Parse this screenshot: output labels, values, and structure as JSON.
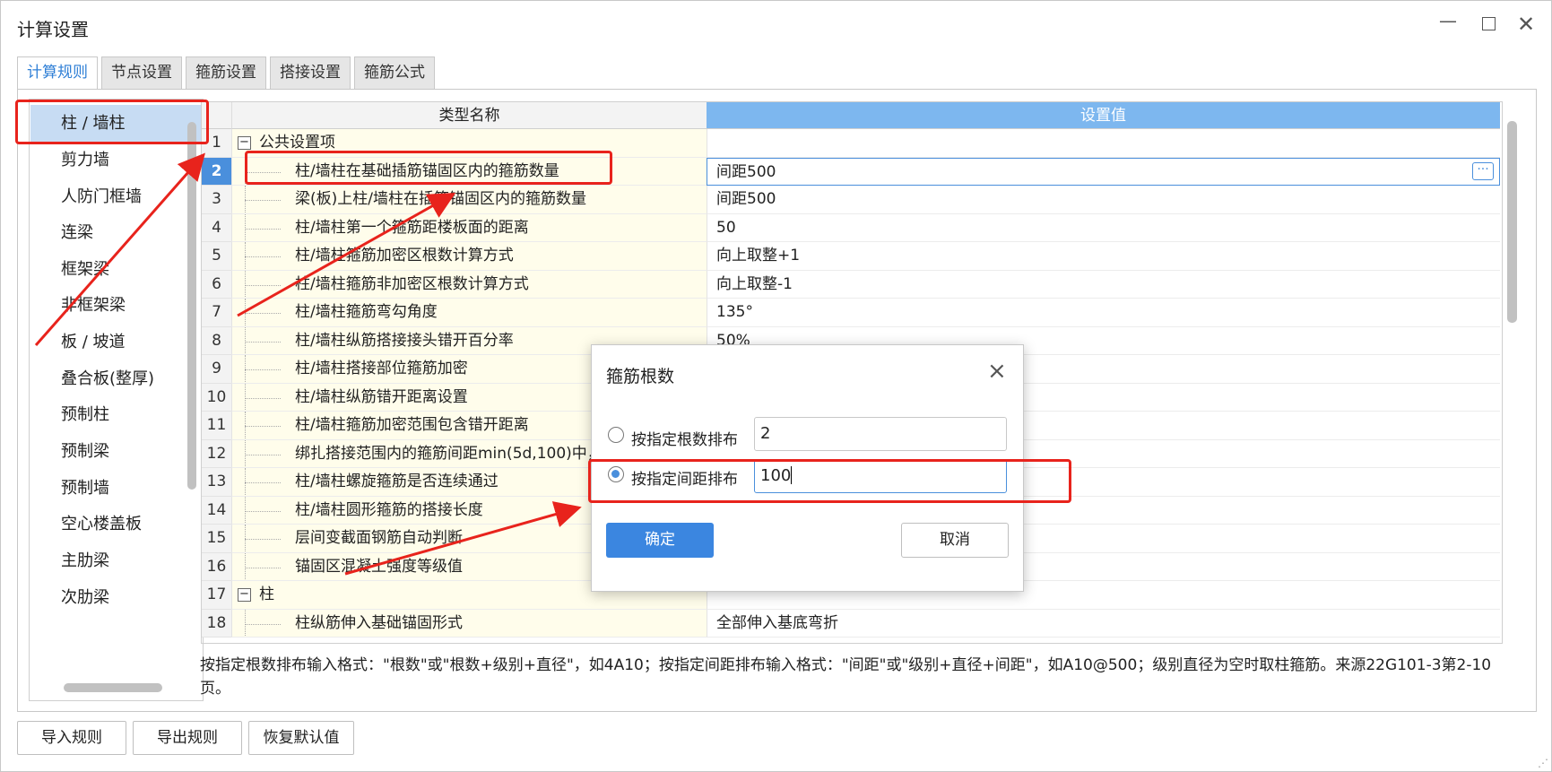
{
  "window": {
    "title": "计算设置"
  },
  "tabs": [
    "计算规则",
    "节点设置",
    "箍筋设置",
    "搭接设置",
    "箍筋公式"
  ],
  "sidebar": {
    "items": [
      "柱 / 墙柱",
      "剪力墙",
      "人防门框墙",
      "连梁",
      "框架梁",
      "非框架梁",
      "板 / 坡道",
      "叠合板(整厚)",
      "预制柱",
      "预制梁",
      "预制墙",
      "空心楼盖板",
      "主肋梁",
      "次肋梁"
    ]
  },
  "grid": {
    "headers": {
      "name": "类型名称",
      "value": "设置值"
    },
    "rows": [
      {
        "n": "1",
        "name": "公共设置项",
        "value": ""
      },
      {
        "n": "2",
        "name": "柱/墙柱在基础插筋锚固区内的箍筋数量",
        "value": "间距500"
      },
      {
        "n": "3",
        "name": "梁(板)上柱/墙柱在插筋锚固区内的箍筋数量",
        "value": "间距500"
      },
      {
        "n": "4",
        "name": "柱/墙柱第一个箍筋距楼板面的距离",
        "value": "50"
      },
      {
        "n": "5",
        "name": "柱/墙柱箍筋加密区根数计算方式",
        "value": "向上取整+1"
      },
      {
        "n": "6",
        "name": "柱/墙柱箍筋非加密区根数计算方式",
        "value": "向上取整-1"
      },
      {
        "n": "7",
        "name": "柱/墙柱箍筋弯勾角度",
        "value": "135°"
      },
      {
        "n": "8",
        "name": "柱/墙柱纵筋搭接接头错开百分率",
        "value": "50%"
      },
      {
        "n": "9",
        "name": "柱/墙柱搭接部位箍筋加密",
        "value": ""
      },
      {
        "n": "10",
        "name": "柱/墙柱纵筋错开距离设置",
        "value": ""
      },
      {
        "n": "11",
        "name": "柱/墙柱箍筋加密范围包含错开距离",
        "value": ""
      },
      {
        "n": "12",
        "name": "绑扎搭接范围内的箍筋间距min(5d,100)中，",
        "value": ""
      },
      {
        "n": "13",
        "name": "柱/墙柱螺旋箍筋是否连续通过",
        "value": ""
      },
      {
        "n": "14",
        "name": "柱/墙柱圆形箍筋的搭接长度",
        "value": ""
      },
      {
        "n": "15",
        "name": "层间变截面钢筋自动判断",
        "value": ""
      },
      {
        "n": "16",
        "name": "锚固区混凝土强度等级值",
        "value": ""
      },
      {
        "n": "17",
        "name": "柱",
        "value": ""
      },
      {
        "n": "18",
        "name": "柱纵筋伸入基础锚固形式",
        "value": "全部伸入基底弯折"
      }
    ]
  },
  "description": "按指定根数排布输入格式：\"根数\"或\"根数+级别+直径\"，如4A10；按指定间距排布输入格式：\"间距\"或\"级别+直径+间距\"，如A10@500；级别直径为空时取柱箍筋。来源22G101-3第2-10页。",
  "buttons": {
    "import": "导入规则",
    "export": "导出规则",
    "restore": "恢复默认值"
  },
  "dialog": {
    "title": "箍筋根数",
    "option_count_label": "按指定根数排布",
    "option_count_value": "2",
    "option_spacing_label": "按指定间距排布",
    "option_spacing_value": "100",
    "selected": "spacing",
    "ok": "确定",
    "cancel": "取消"
  },
  "colors": {
    "accent": "#4a8fdc",
    "header_value_bg": "#7db7ef",
    "annotation": "#e8231c"
  }
}
